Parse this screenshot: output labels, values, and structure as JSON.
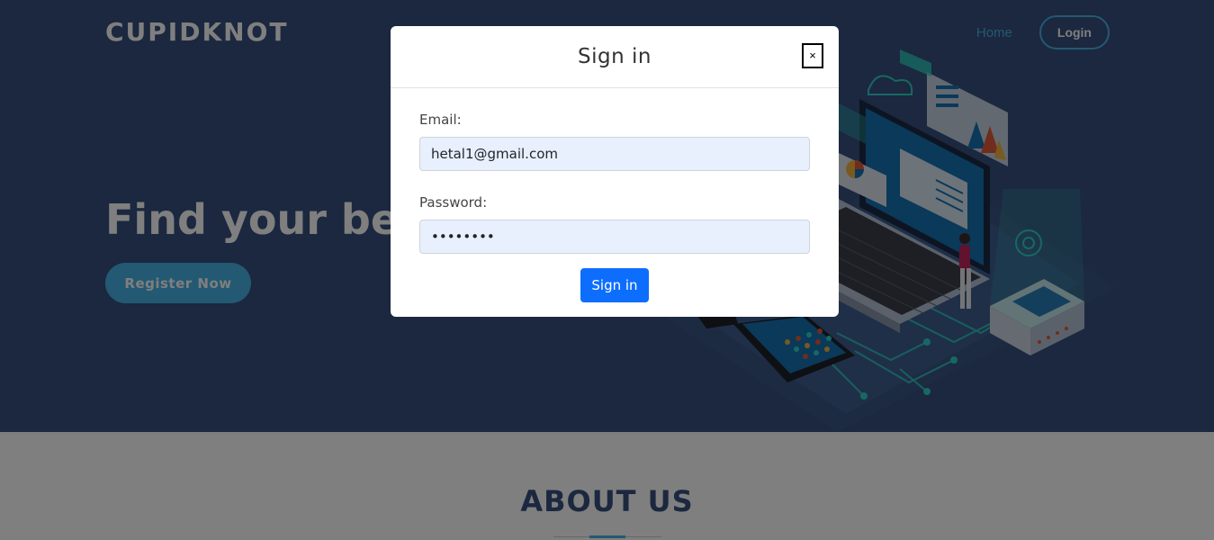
{
  "header": {
    "brand": "CUPIDKNOT",
    "nav": {
      "home_label": "Home",
      "login_label": "Login"
    }
  },
  "hero": {
    "title": "Find your better half",
    "register_label": "Register Now"
  },
  "about": {
    "title": "ABOUT US"
  },
  "modal": {
    "title": "Sign in",
    "close_label": "×",
    "email_label": "Email:",
    "email_value": "hetal1@gmail.com",
    "password_label": "Password:",
    "password_value": "••••••••",
    "submit_label": "Sign in"
  },
  "colors": {
    "hero_background": "#37517e",
    "accent": "#47b2e4",
    "primary_button": "#0d6efd",
    "autofill_input": "#e8f0fe"
  },
  "icons": {
    "close": "close-icon",
    "illustration": "laptop-devices-illustration"
  }
}
